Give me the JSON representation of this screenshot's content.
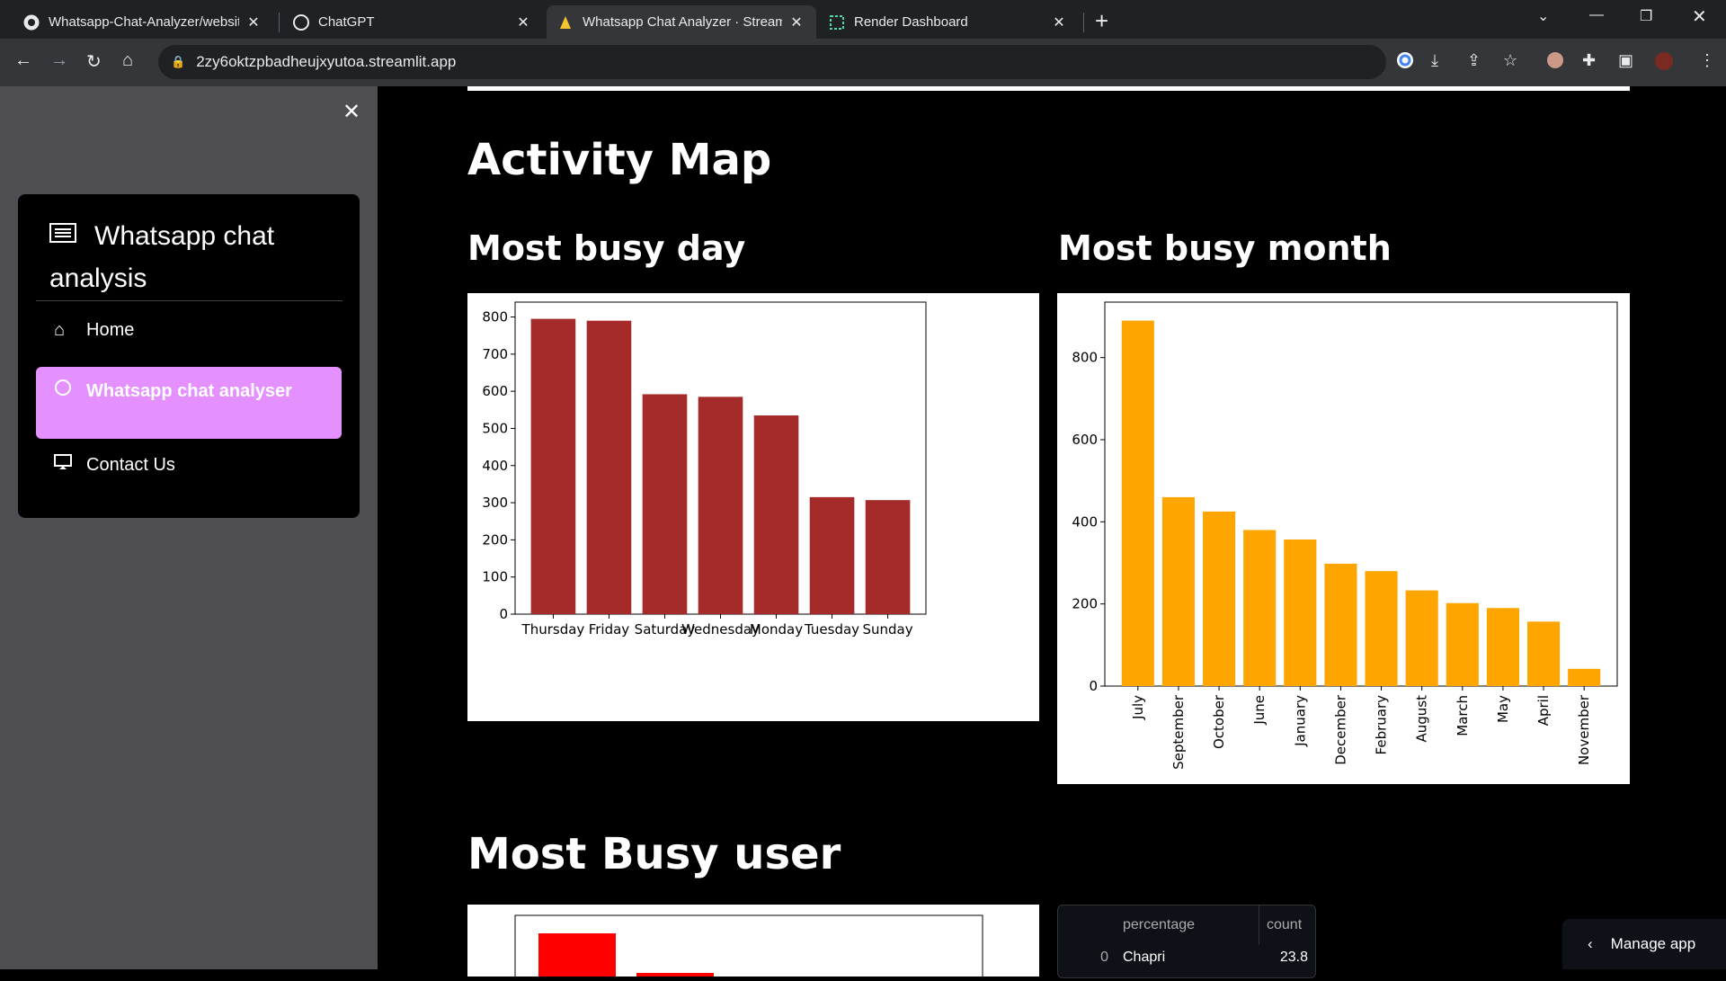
{
  "browser": {
    "tabs": [
      {
        "title": "Whatsapp-Chat-Analyzer/websit",
        "icon": "github-icon"
      },
      {
        "title": "ChatGPT",
        "icon": "chatgpt-icon"
      },
      {
        "title": "Whatsapp Chat Analyzer · Stream",
        "icon": "streamlit-icon",
        "active": true
      },
      {
        "title": "Render Dashboard",
        "icon": "render-icon"
      }
    ],
    "url": "2zy6oktzpbadheujxyutoa.streamlit.app"
  },
  "sidebar": {
    "title": "Whatsapp chat analysis",
    "items": [
      {
        "label": "Home",
        "icon": "home-icon"
      },
      {
        "label": "Whatsapp chat analyser",
        "icon": "whatsapp-icon",
        "active": true
      },
      {
        "label": "Contact Us",
        "icon": "monitor-icon"
      }
    ],
    "accent": "#e590ff"
  },
  "main": {
    "activity_heading": "Activity Map",
    "busy_day_heading": "Most busy day",
    "busy_month_heading": "Most busy month",
    "busy_user_heading": "Most Busy user",
    "table": {
      "headers": [
        "",
        "percentage",
        "count"
      ],
      "rows": [
        [
          "0",
          "Chapri",
          "23.8"
        ]
      ]
    },
    "manage_label": "Manage app"
  },
  "chart_data": [
    {
      "type": "bar",
      "categories": [
        "Thursday",
        "Friday",
        "Saturday",
        "Wednesday",
        "Monday",
        "Tuesday",
        "Sunday"
      ],
      "values": [
        795,
        790,
        592,
        585,
        535,
        315,
        307
      ],
      "ylim": [
        0,
        840
      ],
      "yticks": [
        0,
        100,
        200,
        300,
        400,
        500,
        600,
        700,
        800
      ],
      "color": "#a52a2a"
    },
    {
      "type": "bar",
      "categories": [
        "July",
        "September",
        "October",
        "June",
        "January",
        "December",
        "February",
        "August",
        "March",
        "May",
        "April",
        "November"
      ],
      "values": [
        890,
        460,
        425,
        380,
        357,
        298,
        280,
        233,
        202,
        190,
        157,
        42
      ],
      "ylim": [
        0,
        935
      ],
      "yticks": [
        0,
        200,
        400,
        600,
        800
      ],
      "color": "#ffa500"
    }
  ]
}
